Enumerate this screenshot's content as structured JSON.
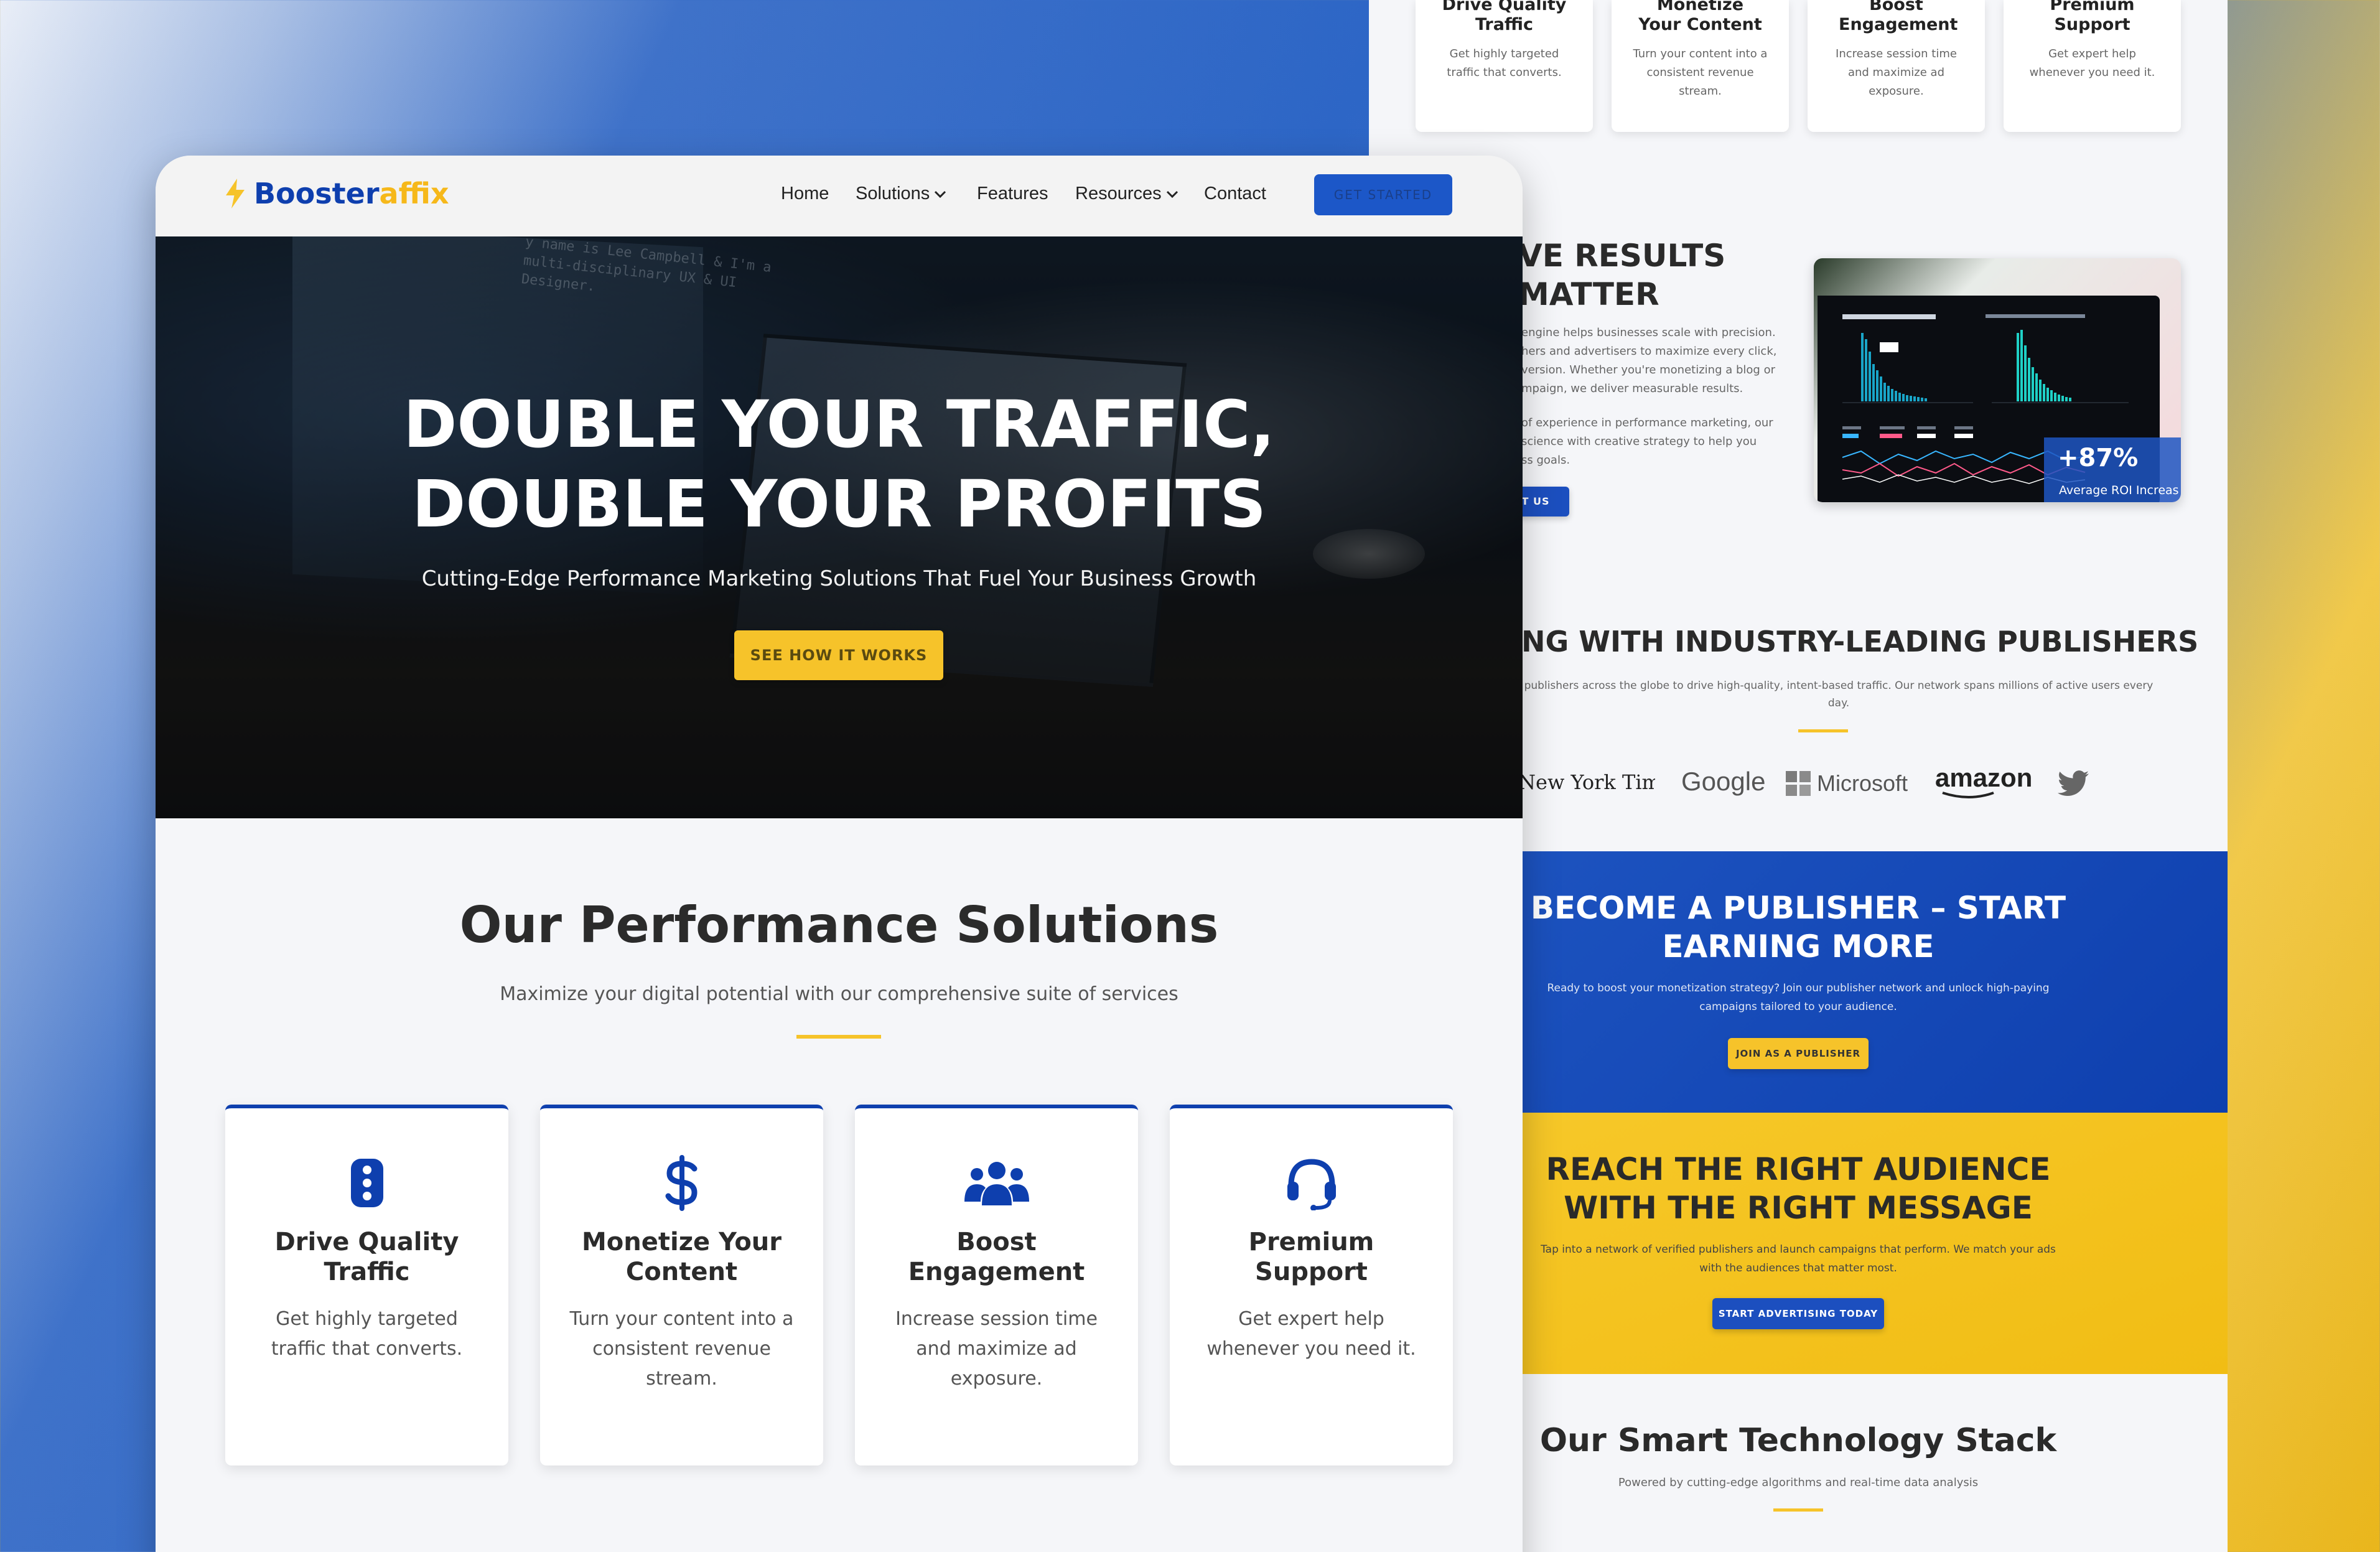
{
  "colors": {
    "primary_blue": "#0e3fae",
    "accent_yellow": "#f6c32a",
    "text_dark": "#2b2b2b"
  },
  "back_page": {
    "top_cards": [
      {
        "title": "Drive Quality Traffic",
        "desc": "Get highly targeted traffic that converts."
      },
      {
        "title": "Monetize Your Content",
        "desc": "Turn your content into a consistent revenue stream."
      },
      {
        "title": "Boost Engagement",
        "desc": "Increase session time and maximize ad exposure."
      },
      {
        "title": "Premium Support",
        "desc": "Get expert help whenever you need it."
      }
    ],
    "results": {
      "title_line1": "VE RESULTS",
      "title_line2": "MATTER",
      "para1": [
        " engine helps businesses scale with precision.",
        "hers and advertisers to maximize every click,",
        "version. Whether you're monetizing a blog or",
        "mpaign, we deliver measurable results."
      ],
      "para2": [
        " of experience in performance marketing, our",
        " science with creative strategy to help you",
        "ss goals."
      ],
      "button": "UT US",
      "roi_value": "+87%",
      "roi_label": "Average ROI Increas"
    },
    "publishers": {
      "title": "NG WITH INDUSTRY-LEADING PUBLISHERS",
      "desc_line1": " publishers across the globe to drive high-quality, intent-based traffic. Our network spans millions of active users every",
      "desc_line2": "day.",
      "logos": {
        "nyt": "New York Times",
        "google": "Google",
        "microsoft": "Microsoft",
        "amazon": "amazon"
      }
    },
    "publisher_cta": {
      "title_line1": "BECOME A PUBLISHER – START",
      "title_line2": "EARNING MORE",
      "desc_line1": "Ready to boost your monetization strategy? Join our publisher network and unlock high-paying",
      "desc_line2": "campaigns tailored to your audience.",
      "button": "JOIN AS A PUBLISHER"
    },
    "advertiser_cta": {
      "title_line1": "REACH THE RIGHT AUDIENCE",
      "title_line2": "WITH THE RIGHT MESSAGE",
      "desc_line1": "Tap into a network of verified publishers and launch campaigns that perform. We match your ads",
      "desc_line2": "with the audiences that matter most.",
      "button": "START ADVERTISING TODAY"
    },
    "tech": {
      "title": "Our Smart Technology Stack",
      "subtitle": "Powered by cutting-edge algorithms and real-time data analysis"
    }
  },
  "front_page": {
    "logo": {
      "part1": "Booster",
      "part2": "affix"
    },
    "nav": [
      "Home",
      "Solutions",
      "Features",
      "Resources",
      "Contact"
    ],
    "cta_button": "GET STARTED",
    "hero": {
      "title_line1": "DOUBLE YOUR TRAFFIC,",
      "title_line2": "DOUBLE YOUR PROFITS",
      "subtitle": "Cutting-Edge Performance Marketing Solutions That Fuel Your Business Growth",
      "button": "SEE HOW IT WORKS",
      "screen_text": [
        "y name is Lee Campbell & I'm a",
        "multi-disciplinary UX & UI",
        "Designer."
      ]
    },
    "solutions": {
      "title": "Our Performance Solutions",
      "subtitle": "Maximize your digital potential with our comprehensive suite of services",
      "cards": [
        {
          "icon": "traffic-light-icon",
          "title_line1": "Drive Quality",
          "title_line2": "Traffic",
          "desc_line1": "Get highly targeted",
          "desc_line2": "traffic that converts.",
          "desc_line3": ""
        },
        {
          "icon": "dollar-icon",
          "title_line1": "Monetize Your",
          "title_line2": "Content",
          "desc_line1": "Turn your content into a",
          "desc_line2": "consistent revenue",
          "desc_line3": "stream."
        },
        {
          "icon": "users-icon",
          "title_line1": "Boost",
          "title_line2": "Engagement",
          "desc_line1": "Increase session time",
          "desc_line2": "and maximize ad",
          "desc_line3": "exposure."
        },
        {
          "icon": "headset-icon",
          "title_line1": "Premium",
          "title_line2": "Support",
          "desc_line1": "Get expert help",
          "desc_line2": "whenever you need it.",
          "desc_line3": ""
        }
      ]
    }
  }
}
